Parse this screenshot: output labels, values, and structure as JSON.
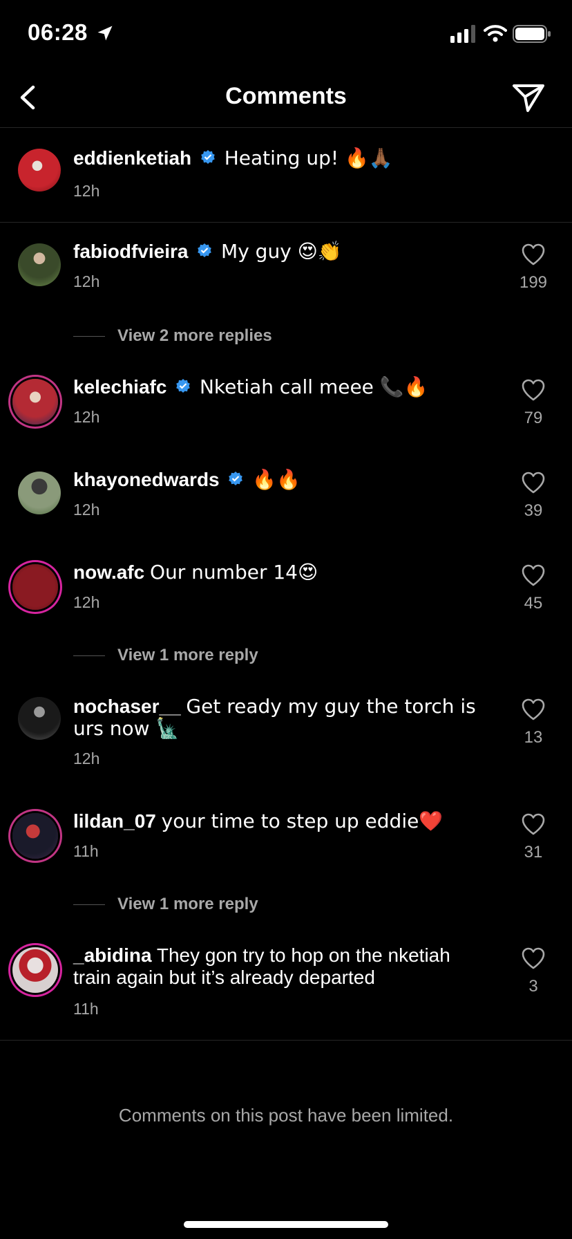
{
  "status_bar": {
    "time": "06:28"
  },
  "header": {
    "title": "Comments"
  },
  "caption": {
    "username": "eddienketiah",
    "verified": true,
    "text": "Heating up! 🔥🙏🏾",
    "time": "12h"
  },
  "comments": [
    {
      "username": "fabiodfvieira",
      "verified": true,
      "text": "My guy 😍👏",
      "time": "12h",
      "likes": "199"
    },
    {
      "username": "kelechiafc",
      "verified": true,
      "text": "Nketiah call meee 📞🔥",
      "time": "12h",
      "likes": "79"
    },
    {
      "username": "khayonedwards",
      "verified": true,
      "text": "🔥🔥",
      "time": "12h",
      "likes": "39"
    },
    {
      "username": "now.afc",
      "verified": false,
      "text": "Our number 14😍",
      "time": "12h",
      "likes": "45"
    },
    {
      "username": "nochaser__",
      "verified": false,
      "text": "Get ready my guy the torch is urs now 🗽",
      "time": "12h",
      "likes": "13"
    },
    {
      "username": "lildan_07",
      "verified": false,
      "text": "your time to step up eddie❤️",
      "time": "11h",
      "likes": "31"
    },
    {
      "username": "_abidina",
      "verified": false,
      "text": "They gon try to hop on the nketiah train again but it’s already departed",
      "time": "11h",
      "likes": "3"
    }
  ],
  "view_replies": [
    "View 2 more replies",
    "View 1 more reply",
    "View 1 more reply"
  ],
  "footer": {
    "limited_text": "Comments on this post have been limited."
  },
  "colors": {
    "background": "#000000",
    "secondary_text": "#a8a8a8",
    "verified_blue": "#3797f0",
    "divider": "#262626"
  },
  "icons": [
    "location-arrow-icon",
    "signal-icon",
    "wifi-icon",
    "battery-icon",
    "back-chevron-icon",
    "send-icon",
    "verified-badge-icon",
    "heart-icon"
  ]
}
